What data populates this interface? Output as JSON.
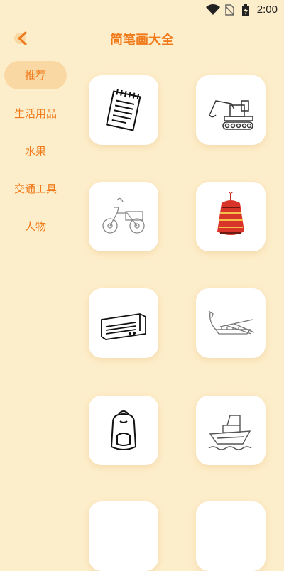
{
  "status_bar": {
    "time": "2:00"
  },
  "header": {
    "title": "简笔画大全"
  },
  "sidebar": {
    "items": [
      {
        "label": "推荐",
        "active": true
      },
      {
        "label": "生活用品",
        "active": false
      },
      {
        "label": "水果",
        "active": false
      },
      {
        "label": "交通工具",
        "active": false
      },
      {
        "label": "人物",
        "active": false
      }
    ]
  },
  "grid": {
    "items": [
      {
        "icon": "notepad-drawing"
      },
      {
        "icon": "excavator-drawing"
      },
      {
        "icon": "tricycle-drawing"
      },
      {
        "icon": "lantern-drawing"
      },
      {
        "icon": "air-conditioner-drawing"
      },
      {
        "icon": "dragon-boat-drawing"
      },
      {
        "icon": "backpack-drawing"
      },
      {
        "icon": "ship-drawing"
      }
    ]
  },
  "colors": {
    "background": "#fdeecb",
    "accent": "#f07a1a",
    "active_tab": "#f9d8a4"
  }
}
